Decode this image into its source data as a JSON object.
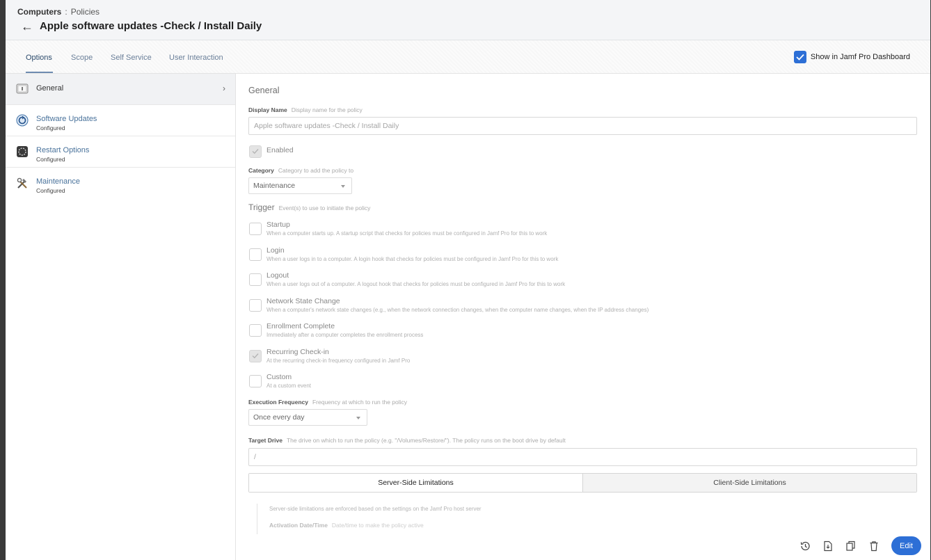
{
  "breadcrumb": {
    "root": "Computers",
    "separator": ":",
    "current": "Policies"
  },
  "page_title": "Apple software updates -Check / Install Daily",
  "tabs": [
    {
      "label": "Options",
      "active": true
    },
    {
      "label": "Scope",
      "active": false
    },
    {
      "label": "Self Service",
      "active": false
    },
    {
      "label": "User Interaction",
      "active": false
    }
  ],
  "dashboard_toggle": {
    "label": "Show in Jamf Pro Dashboard",
    "checked": true
  },
  "sidebar": {
    "items": [
      {
        "label": "General",
        "sub": "",
        "icon": "general-icon",
        "active": true
      },
      {
        "label": "Software Updates",
        "sub": "Configured",
        "icon": "software-update-icon",
        "active": false
      },
      {
        "label": "Restart Options",
        "sub": "Configured",
        "icon": "restart-icon",
        "active": false
      },
      {
        "label": "Maintenance",
        "sub": "Configured",
        "icon": "tools-icon",
        "active": false
      }
    ]
  },
  "general": {
    "title": "General",
    "display_name": {
      "label": "Display Name",
      "hint": "Display name for the policy",
      "value": "Apple software updates -Check / Install Daily"
    },
    "enabled": {
      "label": "Enabled",
      "checked": true
    },
    "category": {
      "label": "Category",
      "hint": "Category to add the policy to",
      "value": "Maintenance"
    },
    "trigger": {
      "label": "Trigger",
      "hint": "Event(s) to use to initiate the policy",
      "items": [
        {
          "label": "Startup",
          "desc": "When a computer starts up. A startup script that checks for policies must be configured in Jamf Pro for this to work",
          "checked": false
        },
        {
          "label": "Login",
          "desc": "When a user logs in to a computer. A login hook that checks for policies must be configured in Jamf Pro for this to work",
          "checked": false
        },
        {
          "label": "Logout",
          "desc": "When a user logs out of a computer. A logout hook that checks for policies must be configured in Jamf Pro for this to work",
          "checked": false
        },
        {
          "label": "Network State Change",
          "desc": "When a computer's network state changes (e.g., when the network connection changes, when the computer name changes, when the IP address changes)",
          "checked": false
        },
        {
          "label": "Enrollment Complete",
          "desc": "Immediately after a computer completes the enrollment process",
          "checked": false
        },
        {
          "label": "Recurring Check-in",
          "desc": "At the recurring check-in frequency configured in Jamf Pro",
          "checked": true
        },
        {
          "label": "Custom",
          "desc": "At a custom event",
          "checked": false
        }
      ]
    },
    "execution_frequency": {
      "label": "Execution Frequency",
      "hint": "Frequency at which to run the policy",
      "value": "Once every day"
    },
    "target_drive": {
      "label": "Target Drive",
      "hint": "The drive on which to run the policy (e.g. \"/Volumes/Restore/\"). The policy runs on the boot drive by default",
      "value": "/"
    },
    "limitations": {
      "server_label": "Server-Side Limitations",
      "client_label": "Client-Side Limitations",
      "server_desc": "Server-side limitations are enforced based on the settings on the Jamf Pro host server",
      "activation_label": "Activation Date/Time",
      "activation_hint": "Date/time to make the policy active"
    }
  },
  "footer": {
    "icons": [
      "history-icon",
      "download-log-icon",
      "clone-icon",
      "delete-icon"
    ],
    "edit_label": "Edit"
  },
  "colors": {
    "accent": "#2d6fd6",
    "link": "#49729b"
  }
}
